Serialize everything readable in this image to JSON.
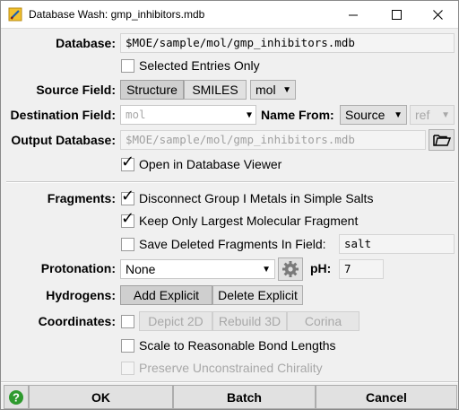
{
  "window": {
    "title": "Database Wash: gmp_inhibitors.mdb"
  },
  "database": {
    "label": "Database:",
    "value": "$MOE/sample/mol/gmp_inhibitors.mdb"
  },
  "selected_entries": {
    "label": "Selected Entries Only",
    "checked": false
  },
  "source_field": {
    "label": "Source Field:",
    "buttons": [
      "Structure",
      "SMILES"
    ],
    "selected": "Structure",
    "field_value": "mol"
  },
  "destination_field": {
    "label": "Destination Field:",
    "placeholder": "mol"
  },
  "name_from": {
    "label": "Name From:",
    "value": "Source",
    "ref_value": "ref"
  },
  "output_database": {
    "label": "Output Database:",
    "placeholder": "$MOE/sample/mol/gmp_inhibitors.mdb"
  },
  "open_in_viewer": {
    "label": "Open in Database Viewer",
    "checked": true
  },
  "fragments": {
    "label": "Fragments:",
    "disconnect": {
      "label": "Disconnect Group I Metals in Simple Salts",
      "checked": true
    },
    "keep_largest": {
      "label": "Keep Only Largest Molecular Fragment",
      "checked": true
    },
    "save_deleted": {
      "label": "Save Deleted Fragments In Field:",
      "checked": false,
      "field_value": "salt"
    }
  },
  "protonation": {
    "label": "Protonation:",
    "value": "None",
    "ph_label": "pH:",
    "ph_value": "7"
  },
  "hydrogens": {
    "label": "Hydrogens:",
    "buttons": [
      "Add Explicit",
      "Delete Explicit"
    ],
    "selected": "Add Explicit"
  },
  "coordinates": {
    "label": "Coordinates:",
    "checked": false,
    "buttons": [
      "Depict 2D",
      "Rebuild 3D",
      "Corina"
    ],
    "scale_bonds": {
      "label": "Scale to Reasonable Bond Lengths",
      "checked": false
    },
    "preserve_chirality": {
      "label": "Preserve Unconstrained Chirality",
      "checked": false
    }
  },
  "footer": {
    "ok": "OK",
    "batch": "Batch",
    "cancel": "Cancel",
    "help_icon": "help-icon"
  },
  "colors": {
    "help_green": "#2e9a2e",
    "title_icon_yellow": "#f2c12e"
  }
}
